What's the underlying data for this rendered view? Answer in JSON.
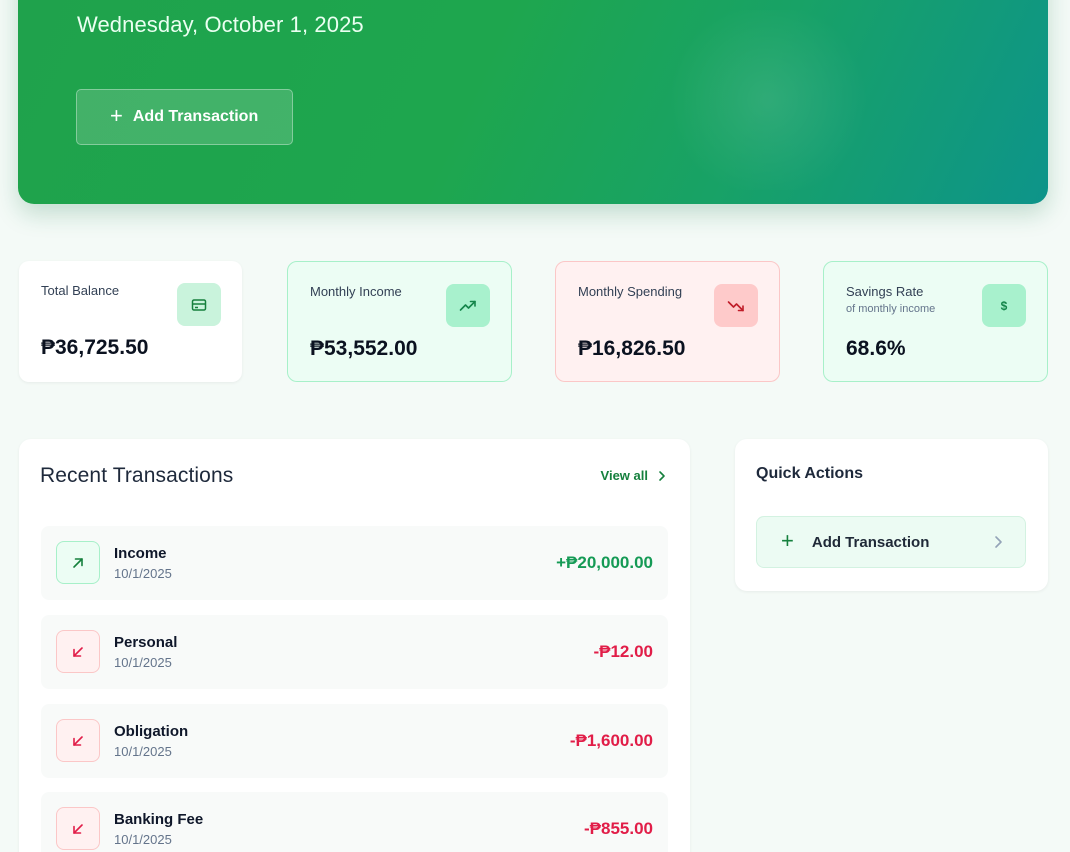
{
  "hero": {
    "date": "Wednesday, October 1, 2025",
    "add_button_label": "Add Transaction"
  },
  "stats": {
    "total_balance": {
      "label": "Total Balance",
      "value": "₱36,725.50",
      "icon": "credit-card-icon"
    },
    "monthly_income": {
      "label": "Monthly Income",
      "value": "₱53,552.00",
      "icon": "trending-up-icon"
    },
    "monthly_spending": {
      "label": "Monthly Spending",
      "value": "₱16,826.50",
      "icon": "trending-down-icon"
    },
    "savings_rate": {
      "label": "Savings Rate",
      "sublabel": "of monthly income",
      "value": "68.6%",
      "icon_glyph": "$"
    }
  },
  "recent": {
    "title": "Recent Transactions",
    "view_all_label": "View all",
    "transactions": [
      {
        "name": "Income",
        "date": "10/1/2025",
        "amount": "+₱20,000.00",
        "type": "income"
      },
      {
        "name": "Personal",
        "date": "10/1/2025",
        "amount": "-₱12.00",
        "type": "expense"
      },
      {
        "name": "Obligation",
        "date": "10/1/2025",
        "amount": "-₱1,600.00",
        "type": "expense"
      },
      {
        "name": "Banking Fee",
        "date": "10/1/2025",
        "amount": "-₱855.00",
        "type": "expense"
      }
    ]
  },
  "quick_actions": {
    "title": "Quick Actions",
    "add_label": "Add Transaction"
  },
  "colors": {
    "accent": "#16a34a",
    "income": "#159a55",
    "expense": "#e11d48"
  }
}
